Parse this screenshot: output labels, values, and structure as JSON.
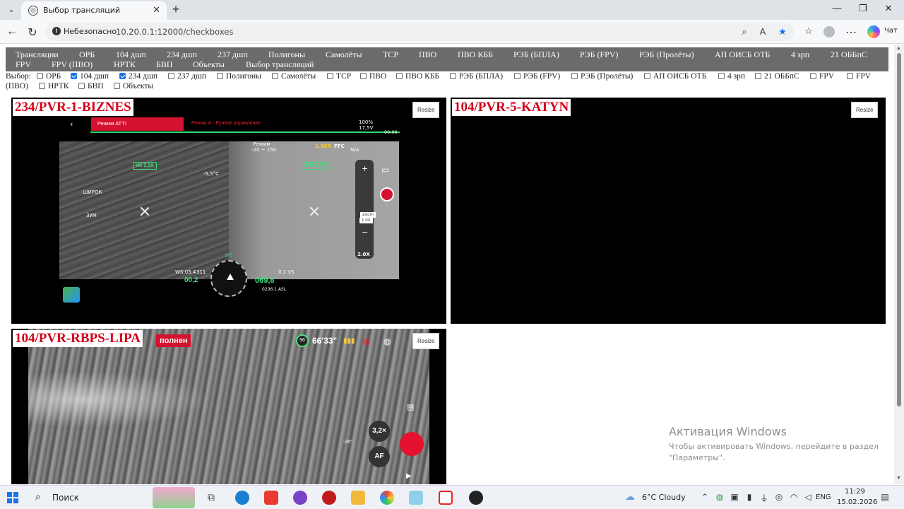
{
  "browser": {
    "tab_title": "Выбор трансляций",
    "security_label": "Небезопасно",
    "url": "10.20.0.1:12000/checkboxes",
    "chat_label": "Чат"
  },
  "menu": {
    "items": [
      "Трансляции",
      "ОРБ",
      "104 дшп",
      "234 дшп",
      "237 дшп",
      "Полигоны",
      "Самолёты",
      "ТСР",
      "ПВО",
      "ПВО КББ",
      "РЭБ (БПЛА)",
      "РЭБ (FPV)",
      "РЭБ (Пролёты)",
      "АП ОИСБ ОТБ",
      "4 зрп",
      "21 ОББпС",
      "FPV",
      "FPV (ПВО)",
      "НРТК",
      "БВП",
      "Объекты",
      "Выбор трансляций"
    ]
  },
  "selection": {
    "label": "Выбор:",
    "options": [
      {
        "label": "ОРБ",
        "checked": false
      },
      {
        "label": "104 дшп",
        "checked": true
      },
      {
        "label": "234 дшп",
        "checked": true
      },
      {
        "label": "237 дшп",
        "checked": false
      },
      {
        "label": "Полигоны",
        "checked": false
      },
      {
        "label": "Самолёты",
        "checked": false
      },
      {
        "label": "ТСР",
        "checked": false
      },
      {
        "label": "ПВО",
        "checked": false
      },
      {
        "label": "ПВО КББ",
        "checked": false
      },
      {
        "label": "РЭБ (БПЛА)",
        "checked": false
      },
      {
        "label": "РЭБ (FPV)",
        "checked": false
      },
      {
        "label": "РЭБ (Пролёты)",
        "checked": false
      },
      {
        "label": "АП ОИСБ ОТБ",
        "checked": false
      },
      {
        "label": "4 зрп",
        "checked": false
      },
      {
        "label": "21 ОББпС",
        "checked": false
      },
      {
        "label": "FPV",
        "checked": false
      },
      {
        "label": "FPV",
        "checked": false
      },
      {
        "label": "(ПВО)",
        "checked": null
      },
      {
        "label": "НРТК",
        "checked": false
      },
      {
        "label": "БВП",
        "checked": false
      },
      {
        "label": "Объекты",
        "checked": false
      }
    ]
  },
  "streams": [
    {
      "title": "234/PVR-1-BIZNES",
      "resize_label": "Resize",
      "hud": {
        "mode": "Режим ATTI",
        "mode_a": "Режим А - Ручное управление",
        "time": "00:06",
        "battery": "100%",
        "voltage": "17,5V",
        "ir_zoom": "ИК 2.0X",
        "zoom": "ЗУМ 1.0X",
        "temp": "-5,5°C",
        "wide": "ШИРОК",
        "zoom_btn": "ЗУМ",
        "zoom_label": "Zoom",
        "zoom_value": "1.0X",
        "zoom_factor": "2.0X",
        "range_mode": "Режим",
        "range": "-20 ~ 150",
        "ir_badge": "2.3KR",
        "ffc": "FFC",
        "na": "N/A",
        "ws": "WS:03.4",
        "heading": "311",
        "h_speed": "00,2",
        "alt": "069,8",
        "vs": "0,1 VS",
        "asl": "0236.1 ASL",
        "compass_deg": "165"
      }
    },
    {
      "title": "104/PVR-5-KATYN",
      "resize_label": "Resize"
    },
    {
      "title": "104/PVR-RBPS-LIPA",
      "resize_label": "Resize",
      "hud": {
        "status": "полнен",
        "battery_pct": "96",
        "timer": "66'33\"",
        "zoom": "3,2×",
        "af": "AF",
        "gimbal": "-26°"
      }
    }
  ],
  "watermark": {
    "title": "Активация Windows",
    "text": "Чтобы активировать Windows, перейдите в раздел \"Параметры\"."
  },
  "taskbar": {
    "search_label": "Поиск",
    "weather": "6°C  Cloudy",
    "language": "ENG",
    "time": "11:29",
    "date": "15.02.2026"
  },
  "colors": {
    "menu_bg": "#6b6b6b",
    "stream_title": "#d3001a",
    "checkbox_on": "#1a73e8"
  }
}
